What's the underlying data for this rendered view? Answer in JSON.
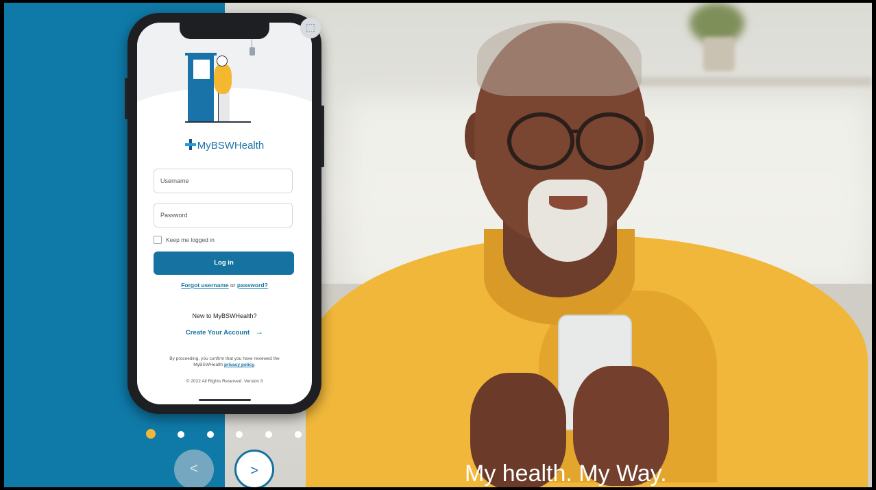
{
  "phone": {
    "brand": "MyBSWHealth",
    "username_placeholder": "Username",
    "password_placeholder": "Password",
    "keep_logged_in": "Keep me logged in",
    "login_label": "Log in",
    "forgot_username": "Forgot username",
    "forgot_or": " or ",
    "forgot_password": "password?",
    "new_to": "New to MyBSWHealth?",
    "create_account": "Create Your Account",
    "consent_prefix": "By proceeding, you confirm that you have reviewed the MyBSWHealth ",
    "privacy_policy": "privacy policy",
    "consent_suffix": ".",
    "copyright": "© 2022 All Rights Reserved.  Version 3"
  },
  "carousel": {
    "slide_count": 6,
    "active_index": 0,
    "prev_label": "<",
    "next_label": ">"
  },
  "tagline": "My health. My Way.",
  "colors": {
    "brand_blue": "#1572a1",
    "panel_blue": "#0f7aa8",
    "accent_yellow": "#f0b73a"
  },
  "icons": {
    "scan": "scan-icon",
    "arrow": "arrow-right-icon"
  }
}
